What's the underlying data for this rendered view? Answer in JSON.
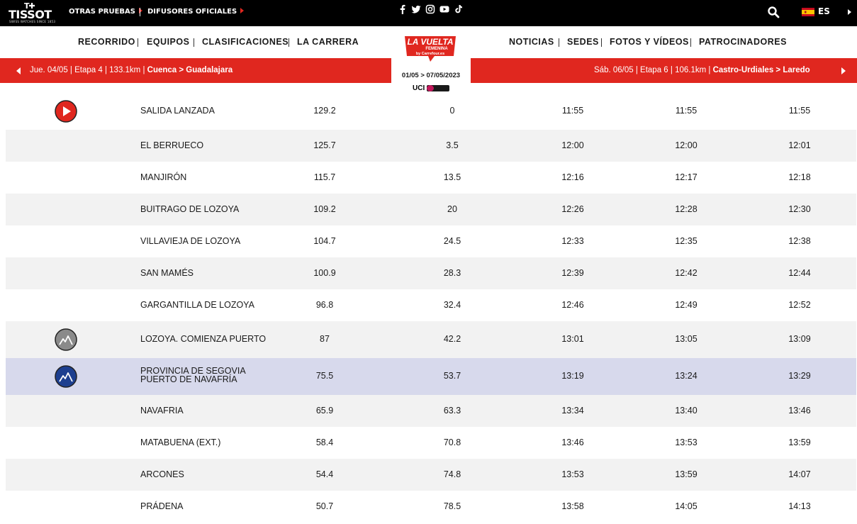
{
  "topbar": {
    "brand_logo": "TISSOT",
    "brand_sub": "SWISS WATCHES SINCE 1853",
    "links": [
      "OTRAS PRUEBAS",
      "DIFUSORES OFICIALES"
    ],
    "social_icons": [
      "facebook-icon",
      "twitter-icon",
      "instagram-icon",
      "youtube-icon",
      "tiktok-icon"
    ],
    "language": "ES"
  },
  "nav": {
    "left": [
      "RECORRIDO",
      "EQUIPOS",
      "CLASIFICACIONES",
      "LA CARRERA"
    ],
    "right": [
      "NOTICIAS",
      "SEDES",
      "FOTOS Y VÍDEOS",
      "PATROCINADORES"
    ]
  },
  "event": {
    "logo_title": "LA VUELTA",
    "logo_sub": "FEMENINA",
    "logo_sponsor": "by Carrefour.es",
    "dates": "01/05 > 07/05/2023",
    "uci": "UCI"
  },
  "stages": {
    "prev": {
      "date": "Jue. 04/05",
      "etapa": "Etapa 4",
      "km": "133.1km",
      "route": "Cuenca > Guadalajara"
    },
    "next": {
      "date": "Sáb. 06/05",
      "etapa": "Etapa 6",
      "km": "106.1km",
      "route": "Castro-Urdiales > Laredo"
    }
  },
  "colors": {
    "accent_red": "#e0271f",
    "row_alt": "#f2f2f2",
    "row_highlight": "#d7d9ec",
    "mountain_blue": "#1d3f8f",
    "mountain_gray": "#8a8a8a"
  },
  "rows": [
    {
      "icon": "play-icon",
      "name": "SALIDA LANZADA",
      "km_rest": "129.2",
      "km_done": "0",
      "t1": "11:55",
      "t2": "11:55",
      "t3": "11:55"
    },
    {
      "icon": "",
      "name": "EL BERRUECO",
      "km_rest": "125.7",
      "km_done": "3.5",
      "t1": "12:00",
      "t2": "12:00",
      "t3": "12:01"
    },
    {
      "icon": "",
      "name": "MANJIRÓN",
      "km_rest": "115.7",
      "km_done": "13.5",
      "t1": "12:16",
      "t2": "12:17",
      "t3": "12:18"
    },
    {
      "icon": "",
      "name": "BUITRAGO DE LOZOYA",
      "km_rest": "109.2",
      "km_done": "20",
      "t1": "12:26",
      "t2": "12:28",
      "t3": "12:30"
    },
    {
      "icon": "",
      "name": "VILLAVIEJA DE LOZOYA",
      "km_rest": "104.7",
      "km_done": "24.5",
      "t1": "12:33",
      "t2": "12:35",
      "t3": "12:38"
    },
    {
      "icon": "",
      "name": "SAN MAMÉS",
      "km_rest": "100.9",
      "km_done": "28.3",
      "t1": "12:39",
      "t2": "12:42",
      "t3": "12:44"
    },
    {
      "icon": "",
      "name": "GARGANTILLA DE LOZOYA",
      "km_rest": "96.8",
      "km_done": "32.4",
      "t1": "12:46",
      "t2": "12:49",
      "t3": "12:52"
    },
    {
      "icon": "mountain-start-icon",
      "name": "LOZOYA. COMIENZA PUERTO",
      "km_rest": "87",
      "km_done": "42.2",
      "t1": "13:01",
      "t2": "13:05",
      "t3": "13:09"
    },
    {
      "icon": "mountain-first-category-icon",
      "name": "PROVINCIA DE SEGOVIA",
      "name2": "PUERTO DE NAVAFRÍA",
      "km_rest": "75.5",
      "km_done": "53.7",
      "t1": "13:19",
      "t2": "13:24",
      "t3": "13:29"
    },
    {
      "icon": "",
      "name": "NAVAFRIA",
      "km_rest": "65.9",
      "km_done": "63.3",
      "t1": "13:34",
      "t2": "13:40",
      "t3": "13:46"
    },
    {
      "icon": "",
      "name": "MATABUENA (EXT.)",
      "km_rest": "58.4",
      "km_done": "70.8",
      "t1": "13:46",
      "t2": "13:53",
      "t3": "13:59"
    },
    {
      "icon": "",
      "name": "ARCONES",
      "km_rest": "54.4",
      "km_done": "74.8",
      "t1": "13:53",
      "t2": "13:59",
      "t3": "14:07"
    },
    {
      "icon": "",
      "name": "PRÁDENA",
      "km_rest": "50.7",
      "km_done": "78.5",
      "t1": "13:58",
      "t2": "14:05",
      "t3": "14:13"
    }
  ]
}
